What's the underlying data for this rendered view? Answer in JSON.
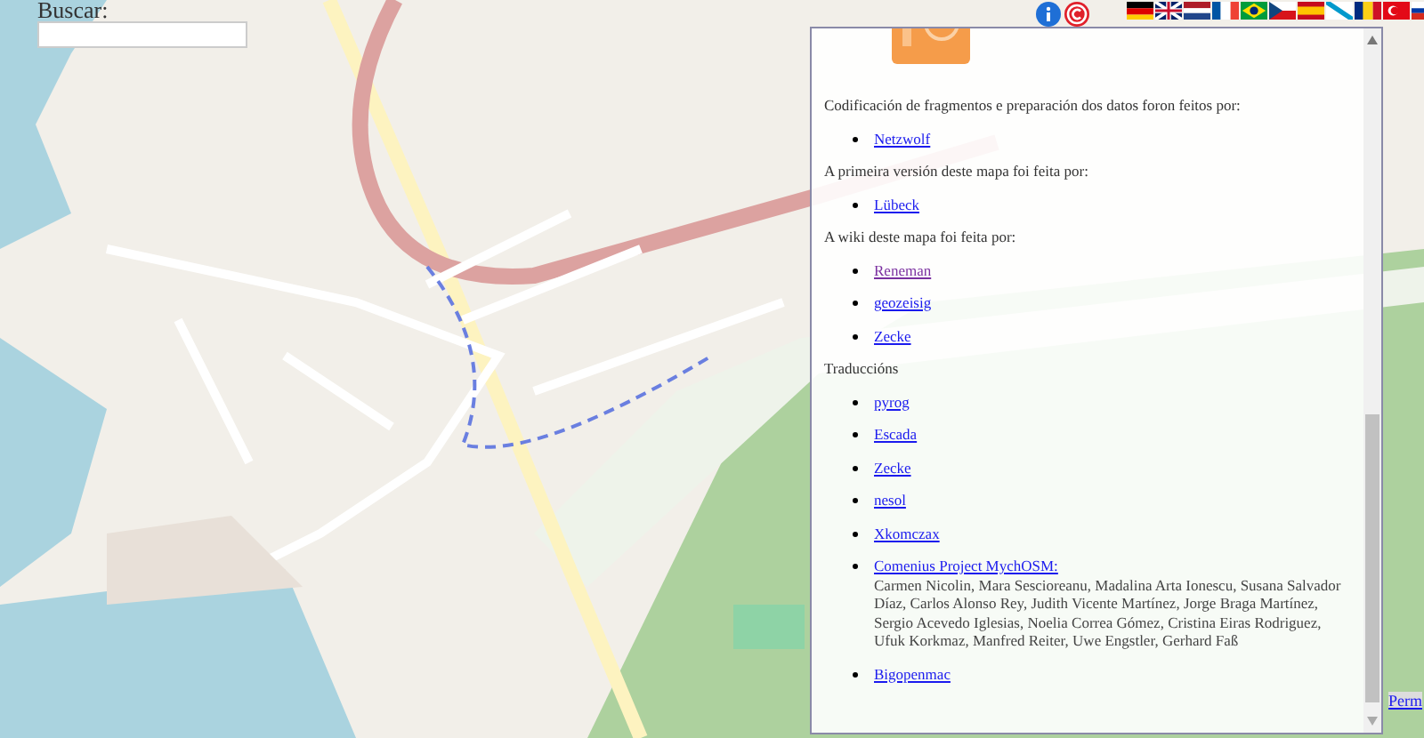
{
  "search": {
    "label": "Buscar:"
  },
  "panel": {
    "sections": [
      {
        "heading": "Codificación de fragmentos e preparación dos datos foron feitos por:",
        "items": [
          {
            "text": "Netzwolf",
            "visited": false
          }
        ]
      },
      {
        "heading": "A primeira versión deste mapa foi feita por:",
        "items": [
          {
            "text": "Lübeck",
            "visited": false
          }
        ]
      },
      {
        "heading": "A wiki deste mapa foi feita por:",
        "items": [
          {
            "text": "Reneman",
            "visited": true
          },
          {
            "text": "geozeisig",
            "visited": false
          },
          {
            "text": "Zecke",
            "visited": false
          }
        ]
      },
      {
        "heading": "Traduccións",
        "items": [
          {
            "text": "pyrog",
            "visited": false
          },
          {
            "text": "Escada",
            "visited": false
          },
          {
            "text": "Zecke",
            "visited": false
          },
          {
            "text": "nesol",
            "visited": false
          },
          {
            "text": "Xkomczax",
            "visited": false
          },
          {
            "text": "Comenius Project MychOSM:",
            "visited": false,
            "note": "Carmen Nicolin, Mara Sescioreanu, Madalina Arta Ionescu, Susana Salvador Díaz, Carlos Alonso Rey, Judith Vicente Martínez, Jorge Braga Martínez, Sergio Acevedo Iglesias, Noelia Correa Gómez, Cristina Eiras Rodriguez, Ufuk Korkmaz, Manfred Reiter, Uwe Engstler, Gerhard Faß"
          },
          {
            "text": "Bigopenmac",
            "visited": false
          }
        ]
      }
    ]
  },
  "permalink": "Perm"
}
